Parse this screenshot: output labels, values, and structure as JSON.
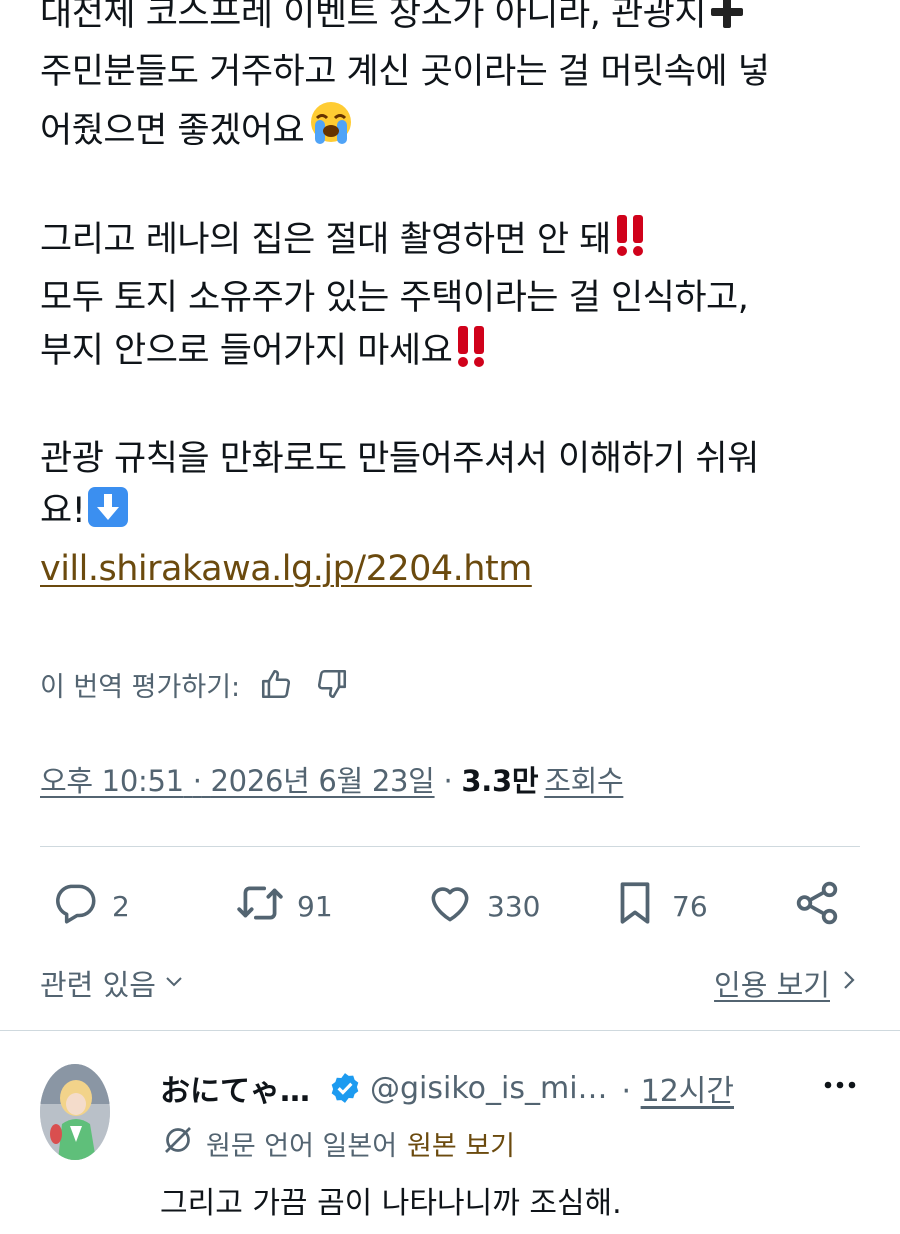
{
  "post": {
    "lines_1": [
      "대전제 코스프레 이벤트 장소가 아니라, 관광지",
      "주민분들도 거주하고 계신 곳이라는 걸 머릿속에 넣",
      "어줬으면 좋겠어요"
    ],
    "lines_2": [
      "그리고 레나의 집은 절대 촬영하면 안 돼",
      "모두 토지 소유주가 있는 주택이라는 걸 인식하고,",
      "부지 안으로 들어가지 마세요"
    ],
    "lines_3": [
      "관광 규칙을 만화로도 만들어주셔서 이해하기 쉬워",
      "요!"
    ],
    "link": "vill.shirakawa.lg.jp/2204.htm",
    "emoji": {
      "plus": "heavy-plus-icon",
      "crying": "loudly-crying-face-icon",
      "double_exclamation": "double-exclamation-icon",
      "down_arrow": "down-arrow-button-icon"
    }
  },
  "rate": {
    "label": "이 번역 평가하기:",
    "up_icon": "thumbs-up-icon",
    "down_icon": "thumbs-down-icon"
  },
  "meta": {
    "time": "오후 10:51",
    "separator": "·",
    "date": "2026년 6월 23일",
    "views_count": "3.3만",
    "views_label": "조회수"
  },
  "actions": {
    "replies": "2",
    "retweets": "91",
    "likes": "330",
    "bookmarks": "76"
  },
  "related": {
    "label": "관련 있음",
    "quotes_label": "인용 보기"
  },
  "reply": {
    "name": "おにてゃ…",
    "handle": "@gisiko_is_mi…",
    "separator": "·",
    "time": "12시간",
    "translated_from": "원문 언어 일본어",
    "show_original": "원본 보기",
    "text": "그리고 가끔 곰이 나타나니까 조심해."
  },
  "colors": {
    "text": "#0f1419",
    "secondary": "#536471",
    "link_brown": "#6b4a0e",
    "divider": "#cfd9de",
    "verified_blue": "#1d9bf0",
    "exclamation_red": "#d0021b"
  }
}
